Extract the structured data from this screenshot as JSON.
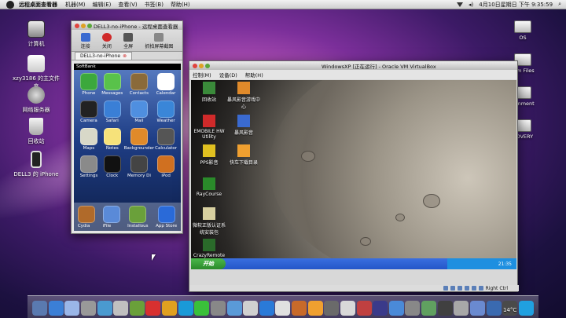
{
  "menubar": {
    "app": "远程桌面查看器",
    "items": [
      "机器(M)",
      "编辑(E)",
      "查看(V)",
      "书签(B)",
      "帮助(H)"
    ],
    "clock": "4月10日星期日 下午 9:35:59"
  },
  "desktop_left": [
    {
      "name": "computer",
      "label": "计算机"
    },
    {
      "name": "home-folder",
      "label": "xzy3186 的主文件夹"
    },
    {
      "name": "network",
      "label": "网络服务器"
    },
    {
      "name": "trash",
      "label": "回收站"
    },
    {
      "name": "device",
      "label": "DELL3 的 iPhone"
    }
  ],
  "desktop_right": [
    "OS",
    "ram Files",
    "tainment",
    "COVERY"
  ],
  "iphone_window": {
    "title": "DELL3-no-iPhone - 远程桌面查看器",
    "tools": [
      "连接",
      "关闭",
      "全屏",
      "抓拍屏幕截图"
    ],
    "tab": "DELL3-no-iPhone",
    "carrier": "SoftBank",
    "apps": [
      "Phone",
      "Messages",
      "Contacts",
      "Calendar",
      "Camera",
      "Safari",
      "Mail",
      "Weather",
      "Maps",
      "Notes",
      "Backgrounder",
      "Calculator",
      "Settings",
      "Clock",
      "Memory Di",
      "iPod",
      "Cydia",
      "iFile",
      "Installous",
      "App Store"
    ],
    "app_colors": [
      "#3ca83c",
      "#59c24a",
      "#8a6a3a",
      "#ffffff",
      "#222222",
      "#3a7fd6",
      "#4f8fe0",
      "#3a86d8",
      "#d8d8c8",
      "#f6e27a",
      "#e08a2a",
      "#555555",
      "#8a8a8a",
      "#111111",
      "#444444",
      "#d07020",
      "#b06a2a",
      "#5a8ad8",
      "#6aa03a",
      "#2a6ad8"
    ]
  },
  "vbox": {
    "title": "WindowsXP [正在运行] - Oracle VM VirtualBox",
    "menu": [
      "控制(M)",
      "设备(D)",
      "帮助(H)"
    ],
    "xp_icons": [
      "回收站",
      "暴风影音游戏中心",
      "EMOBILE HW Utility",
      "暴风影音",
      "PPS影音",
      "快车下载目录",
      "RayCourse",
      "微软正版认证系统安装包",
      "CrazyRemote"
    ],
    "start": "开始",
    "tray_time": "21:35",
    "status": "Right Ctrl"
  },
  "dock_colors": [
    "#5a7ab0",
    "#3b7fd6",
    "#9ab6e8",
    "#999999",
    "#4a9ad0",
    "#c0c0c0",
    "#6aa03a",
    "#d83030",
    "#e0a020",
    "#1a9ad8",
    "#3ac03a",
    "#888888",
    "#5a9ad8",
    "#d0d0d0",
    "#2a7ad8",
    "#e0e0e0",
    "#c86a2a",
    "#f0a030",
    "#6a6a6a",
    "#d8d8d8",
    "#c04040",
    "#3a3a8a",
    "#4a8ad8",
    "#888888",
    "#60a060",
    "#404040",
    "#a8a8a8",
    "#6a8ad0",
    "#3a6ab0",
    "#4a4a4a",
    "#20a0e0"
  ],
  "weather": "14°C"
}
